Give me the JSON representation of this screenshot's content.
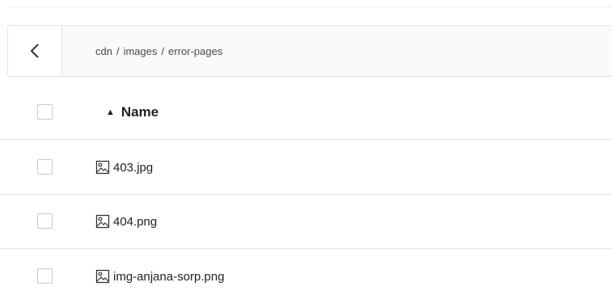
{
  "breadcrumb": {
    "back_icon": "chevron-left-icon",
    "items": [
      "cdn",
      "images",
      "error-pages"
    ],
    "separator": "/"
  },
  "table": {
    "header": {
      "sort_icon": "▲",
      "name_label": "Name"
    },
    "rows": [
      {
        "icon": "image-file-icon",
        "name": "403.jpg"
      },
      {
        "icon": "image-file-icon",
        "name": "404.png"
      },
      {
        "icon": "image-file-icon",
        "name": "img-anjana-sorp.png"
      }
    ]
  }
}
